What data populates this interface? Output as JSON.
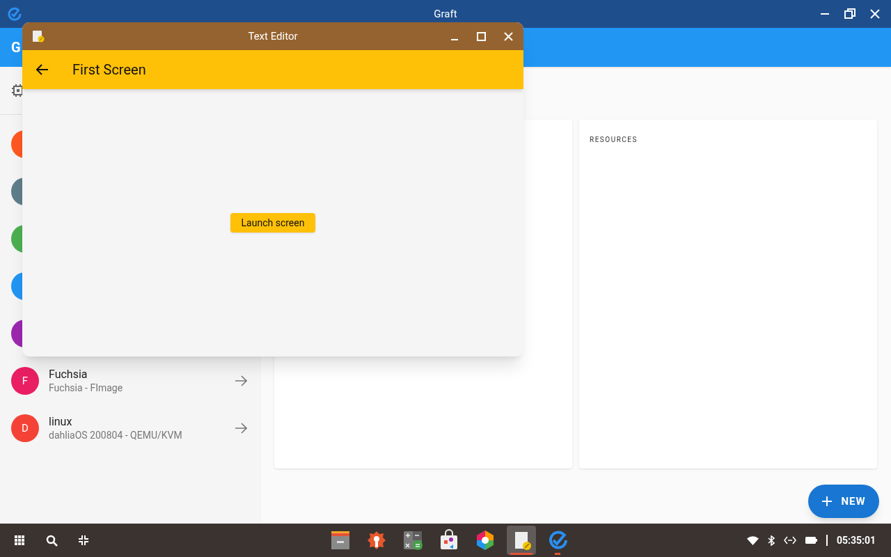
{
  "graft_window": {
    "title": "Graft",
    "app_bar_title": "G",
    "devices": [
      {
        "color": "#ff5722"
      },
      {
        "color": "#607d8b"
      },
      {
        "color": "#4caf50"
      },
      {
        "color": "#2196f3"
      },
      {
        "color": "#9c27b0"
      },
      {
        "letter": "F",
        "name": "Fuchsia",
        "subtitle": "Fuchsia - FImage",
        "color": "#e91e63"
      },
      {
        "letter": "D",
        "name": "linux",
        "subtitle": "dahliaOS 200804 - QEMU/KVM",
        "color": "#f44336"
      }
    ],
    "resources_label": "RESOURCES",
    "fab_label": "NEW"
  },
  "editor_window": {
    "title": "Text Editor",
    "screen_title": "First Screen",
    "launch_button": "Launch screen"
  },
  "taskbar": {
    "apps": [
      {
        "kind": "files",
        "selected": false,
        "running": false
      },
      {
        "kind": "settings",
        "selected": false,
        "running": false
      },
      {
        "kind": "calculator",
        "selected": false,
        "running": false
      },
      {
        "kind": "store",
        "selected": false,
        "running": false
      },
      {
        "kind": "colors",
        "selected": false,
        "running": false
      },
      {
        "kind": "editor",
        "selected": true,
        "running": true
      },
      {
        "kind": "graft",
        "selected": false,
        "running": true
      }
    ],
    "clock": "05:35:01"
  }
}
